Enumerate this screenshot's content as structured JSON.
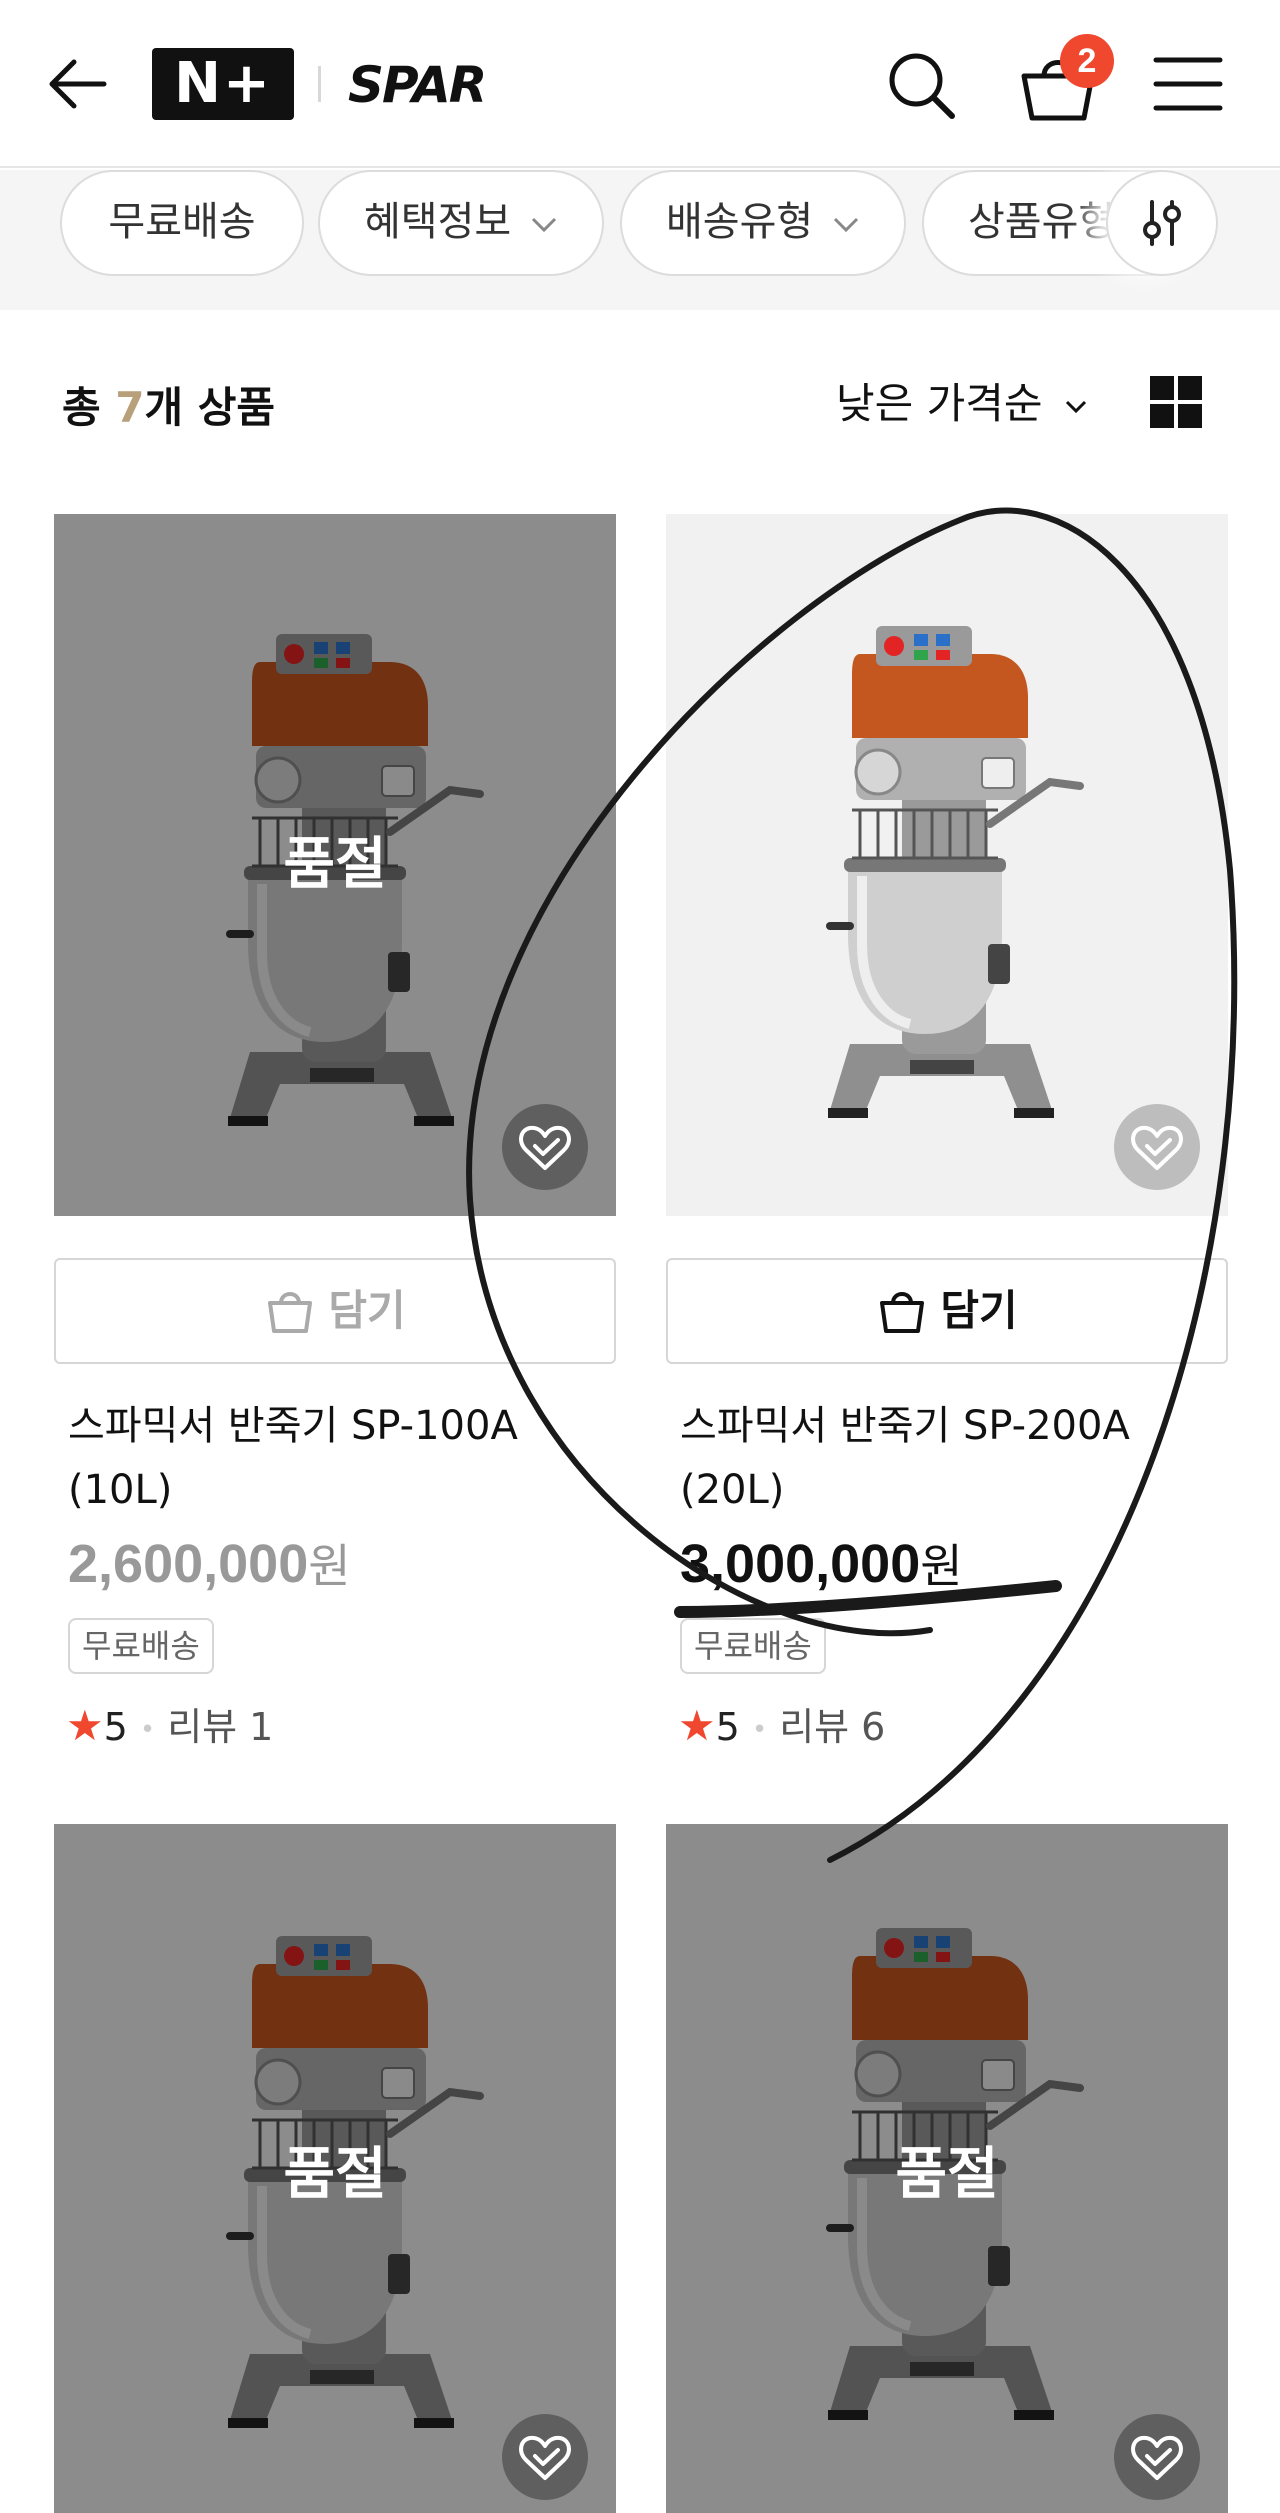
{
  "header": {
    "back_icon": "arrow-left-icon",
    "logo_primary": "N+",
    "logo_secondary": "SPAR",
    "search_icon": "search-icon",
    "cart_icon": "shopping-bag-icon",
    "cart_count": "2",
    "menu_icon": "hamburger-menu-icon"
  },
  "filters": {
    "chips": [
      "무료배송",
      "혜택정보",
      "배송유형",
      "상품유형"
    ],
    "settings_icon": "sliders-icon"
  },
  "summary": {
    "prefix": "총 ",
    "count": "7",
    "suffix": "개 상품",
    "sort_label": "낮은 가격순",
    "view_icon": "grid-view-icon"
  },
  "products": [
    {
      "name": "스파믹서 반죽기 SP-100A (10L)",
      "price": "2,600,000",
      "currency": "원",
      "sold_out": true,
      "sold_out_label": "품절",
      "cart_label": "담기",
      "tag": "무료배송",
      "rating": "5",
      "review_label": "리뷰 1"
    },
    {
      "name": "스파믹서 반죽기 SP-200A (20L)",
      "price": "3,000,000",
      "currency": "원",
      "sold_out": false,
      "cart_label": "담기",
      "tag": "무료배송",
      "rating": "5",
      "review_label": "리뷰 6"
    },
    {
      "sold_out": true,
      "sold_out_label": "품절"
    },
    {
      "sold_out": true,
      "sold_out_label": "품절"
    }
  ],
  "colors": {
    "accent": "#f0482f",
    "count_highlight": "#b8a07a",
    "mixer_body": "#c4561f"
  }
}
